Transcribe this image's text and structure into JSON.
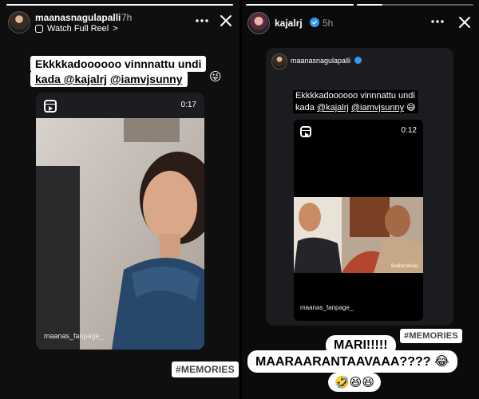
{
  "left_story": {
    "username": "maanasnagulapalli",
    "time": "7h",
    "subtitle": "Watch Full Reel",
    "subtitle_arrow": ">",
    "more_icon": "more-dots-icon",
    "close_icon": "close-icon",
    "caption": {
      "line1": "Ekkkkadoooooo vinnnattu undi",
      "line2_mention1": "kada @kajalrj",
      "line2_mention2": "@iamvjsunny",
      "emoji": "😜"
    },
    "reel": {
      "duration": "0:17",
      "handle": "maanas_fanpage_"
    },
    "sticker": "#MEMORIES"
  },
  "right_story": {
    "username": "kajalrj",
    "verified": true,
    "time": "5h",
    "more_icon": "more-dots-icon",
    "close_icon": "close-icon",
    "shared_post": {
      "username": "maanasnagulapalli",
      "verified": true,
      "caption_line1": "Ekkkkadoooooo vinnnattu undi",
      "caption_line2_prefix": "kada",
      "mention1": "@kajalrj",
      "mention2": "@iamvjsunny",
      "emoji": "😅",
      "reel": {
        "duration": "0:12",
        "handle": "maanas_fanpage_",
        "watermark": "Sneha Music"
      }
    },
    "sticker": "#MEMORIES",
    "text_line1": "MARI!!!!!",
    "text_line2": "MAARAARANTAAVAAA????",
    "text_line2_emoji": "😂",
    "text_line3": "🤣😆😆"
  },
  "colors": {
    "verified_blue": "#3897f0",
    "card_bg": "#1c1d20",
    "sticker_text": "#444444"
  }
}
